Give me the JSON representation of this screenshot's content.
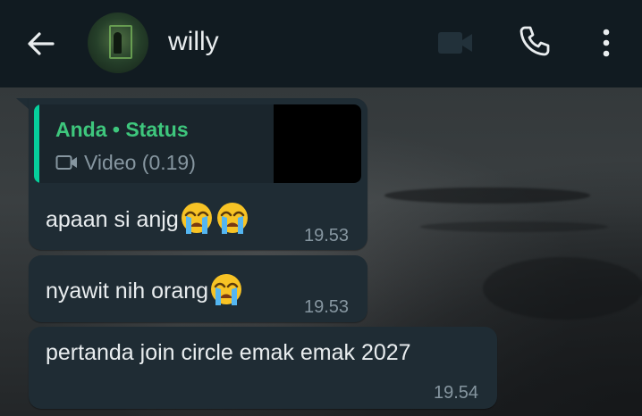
{
  "header": {
    "contact_name": "willy",
    "background": "#111b21"
  },
  "icons": {
    "back": "back-arrow-icon",
    "video_call": "video-camera-icon",
    "voice_call": "phone-icon",
    "menu": "vertical-dots-menu-icon",
    "crying_emoji": "loudly-crying-face-emoji"
  },
  "messages": [
    {
      "quote": {
        "author": "Anda • Status",
        "detail": "Video (0.19)"
      },
      "text": "apaan si anjg",
      "emoji_count": 2,
      "time": "19.53"
    },
    {
      "text": "nyawit nih orang",
      "emoji_count": 1,
      "time": "19.53"
    },
    {
      "text": "pertanda join circle emak emak 2027",
      "emoji_count": 0,
      "time": "19.54"
    }
  ],
  "colors": {
    "bubble": "#1f2c34",
    "accent_green": "#3ec77d",
    "quote_bar": "#06cf9c",
    "meta_gray": "#8696a0",
    "text": "#e9edef"
  }
}
